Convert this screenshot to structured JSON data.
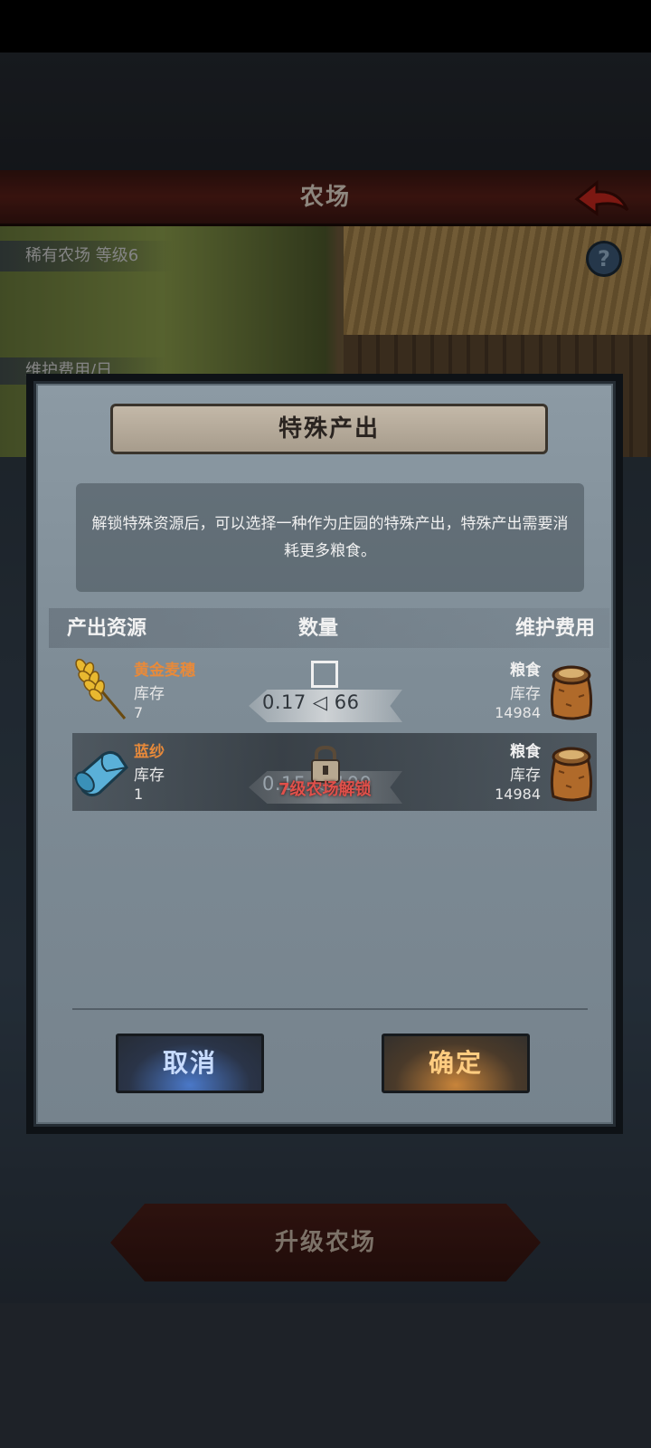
{
  "header": {
    "title": "农场"
  },
  "farm": {
    "label": "稀有农场 等级6",
    "cost_label": "维护费用/日",
    "help_icon": "question-mark-icon"
  },
  "bottom": {
    "upgrade_label": "升级农场"
  },
  "dialog": {
    "title": "特殊产出",
    "description": "解锁特殊资源后，可以选择一种作为庄园的特殊产出，特殊产出需要消耗更多粮食。",
    "columns": {
      "resource": "产出资源",
      "quantity": "数量",
      "cost": "维护费用"
    },
    "rows": [
      {
        "name": "黄金麦穗",
        "stock_label": "库存",
        "stock": "7",
        "ratio": "0.17 ◁ 66",
        "cost_name": "粮食",
        "cost_stock_label": "库存",
        "cost_stock": "14984",
        "icon": "golden-wheat-icon",
        "locked": false
      },
      {
        "name": "蓝纱",
        "stock_label": "库存",
        "stock": "1",
        "ratio": "0.15 ◁ 100",
        "cost_name": "粮食",
        "cost_stock_label": "库存",
        "cost_stock": "14984",
        "icon": "blue-cloth-icon",
        "locked": true,
        "lock_text": "7级农场解锁"
      }
    ],
    "cancel_label": "取消",
    "confirm_label": "确定"
  },
  "colors": {
    "header_red": "#5a1f18",
    "resource_name": "#e88a3a",
    "lock_text": "#e0504a",
    "cancel_glow": "#4a78c8",
    "confirm_glow": "#c8843a"
  }
}
